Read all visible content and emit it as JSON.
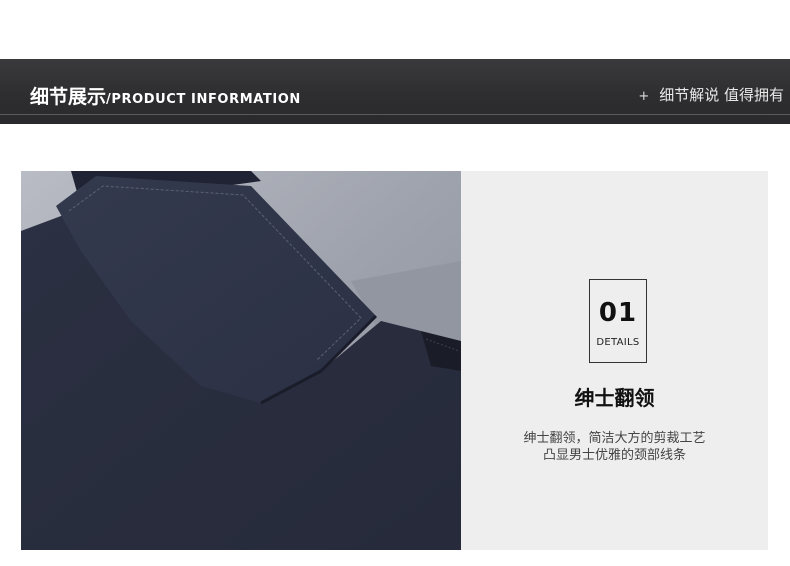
{
  "header": {
    "title_cn": "细节展示",
    "title_en": "/PRODUCT INFORMATION",
    "plus_symbol": "+",
    "tagline": "细节解说 值得拥有"
  },
  "detail": {
    "number": "01",
    "details_label": "DETAILS",
    "feature_title": "绅士翻领",
    "description_line1": "绅士翻领，简洁大方的剪裁工艺",
    "description_line2": "凸显男士优雅的颈部线条"
  },
  "colors": {
    "banner": "#2e2e30",
    "fabric": "#2a2f41",
    "lining": "#a9acb5",
    "panel": "#eeeeee"
  }
}
